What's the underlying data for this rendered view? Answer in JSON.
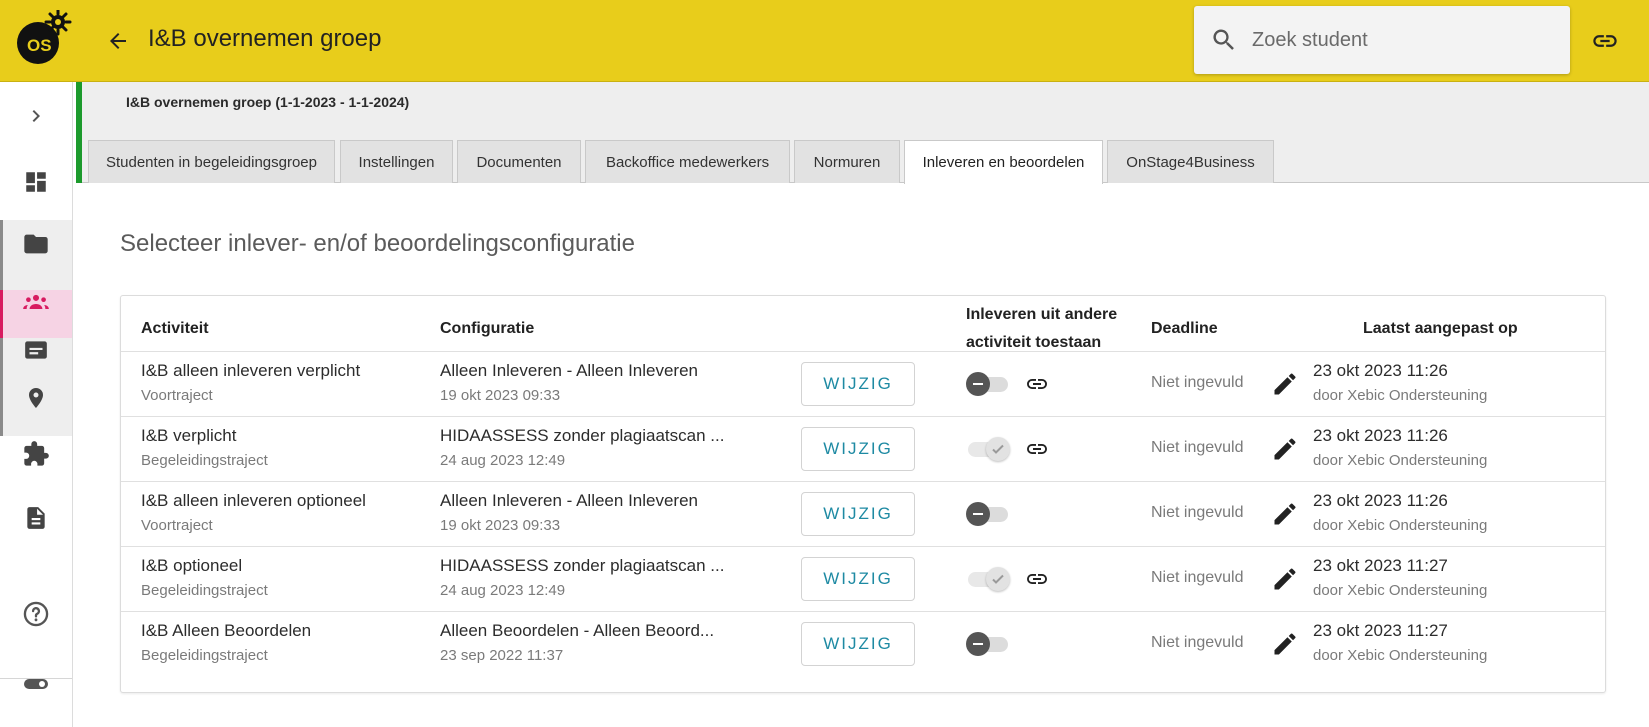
{
  "header": {
    "logo_text": "OS",
    "title": "I&B overnemen groep",
    "search_placeholder": "Zoek student",
    "accent": "#e8cd1b"
  },
  "sidebar": {
    "items": [
      {
        "icon": "chevron-right-icon"
      },
      {
        "icon": "dashboard-icon"
      },
      {
        "icon": "folder-icon"
      },
      {
        "icon": "people-icon",
        "active": true
      },
      {
        "icon": "list-icon"
      },
      {
        "icon": "location-icon"
      },
      {
        "icon": "puzzle-icon"
      },
      {
        "icon": "document-icon"
      },
      {
        "icon": "help-icon"
      },
      {
        "icon": "toggle-icon"
      }
    ],
    "active_color": "#d81b60"
  },
  "group": {
    "subtitle": "I&B overnemen groep (1-1-2023 - 1-1-2024)",
    "tabs": [
      {
        "label": "Studenten in begeleidingsgroep"
      },
      {
        "label": "Instellingen"
      },
      {
        "label": "Documenten"
      },
      {
        "label": "Backoffice medewerkers"
      },
      {
        "label": "Normuren"
      },
      {
        "label": "Inleveren en beoordelen",
        "active": true
      },
      {
        "label": "OnStage4Business"
      }
    ]
  },
  "main": {
    "section_title": "Selecteer inlever- en/of beoordelingsconfiguratie",
    "table": {
      "headers": {
        "activity": "Activiteit",
        "configuration": "Configuratie",
        "allow_line1": "Inleveren uit andere",
        "allow_line2": "activiteit toestaan",
        "deadline": "Deadline",
        "last_modified": "Laatst aangepast op"
      },
      "button_label": "WIJZIG",
      "rows": [
        {
          "activity": "I&B alleen inleveren verplicht",
          "activity_type": "Voortraject",
          "config": "Alleen Inleveren - Alleen Inleveren",
          "config_date": "19 okt 2023 09:33",
          "allow": false,
          "linked": true,
          "deadline": "Niet ingevuld",
          "modified": "23 okt 2023 11:26",
          "modified_by": "door Xebic Ondersteuning"
        },
        {
          "activity": "I&B verplicht",
          "activity_type": "Begeleidingstraject",
          "config": "HIDAASSESS zonder plagiaatscan ...",
          "config_date": "24 aug 2023 12:49",
          "allow": true,
          "linked": true,
          "deadline": "Niet ingevuld",
          "modified": "23 okt 2023 11:26",
          "modified_by": "door Xebic Ondersteuning"
        },
        {
          "activity": "I&B alleen inleveren optioneel",
          "activity_type": "Voortraject",
          "config": "Alleen Inleveren - Alleen Inleveren",
          "config_date": "19 okt 2023 09:33",
          "allow": false,
          "linked": false,
          "deadline": "Niet ingevuld",
          "modified": "23 okt 2023 11:26",
          "modified_by": "door Xebic Ondersteuning"
        },
        {
          "activity": "I&B optioneel",
          "activity_type": "Begeleidingstraject",
          "config": "HIDAASSESS zonder plagiaatscan ...",
          "config_date": "24 aug 2023 12:49",
          "allow": true,
          "linked": true,
          "deadline": "Niet ingevuld",
          "modified": "23 okt 2023 11:27",
          "modified_by": "door Xebic Ondersteuning"
        },
        {
          "activity": "I&B Alleen Beoordelen",
          "activity_type": "Begeleidingstraject",
          "config": "Alleen Beoordelen - Alleen Beoord...",
          "config_date": "23 sep 2022 11:37",
          "allow": false,
          "linked": false,
          "deadline": "Niet ingevuld",
          "modified": "23 okt 2023 11:27",
          "modified_by": "door Xebic Ondersteuning"
        }
      ]
    }
  }
}
